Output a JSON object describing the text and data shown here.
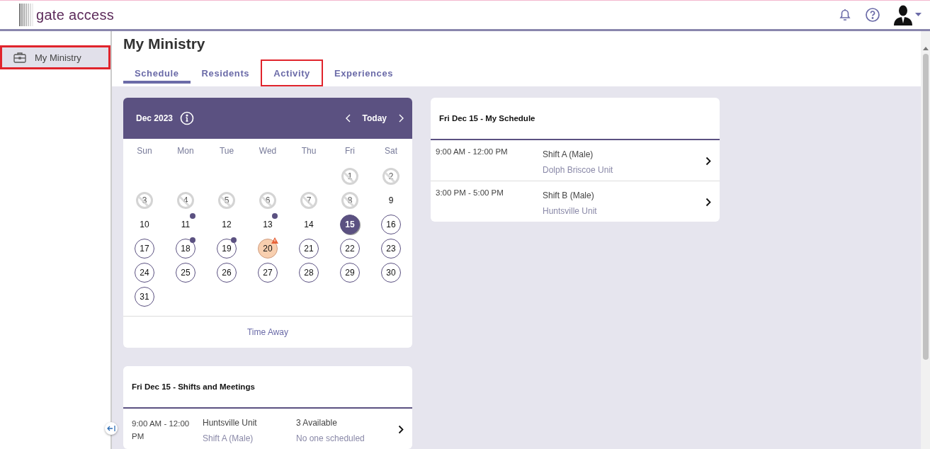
{
  "header": {
    "logo_text": "gate access"
  },
  "sidebar": {
    "items": [
      {
        "label": "My Ministry",
        "selected": true,
        "highlighted": true
      }
    ]
  },
  "page": {
    "title": "My Ministry"
  },
  "tabs": [
    {
      "label": "Schedule",
      "selected": true,
      "highlighted": false
    },
    {
      "label": "Residents",
      "selected": false,
      "highlighted": false
    },
    {
      "label": "Activity",
      "selected": false,
      "highlighted": true
    },
    {
      "label": "Experiences",
      "selected": false,
      "highlighted": false
    }
  ],
  "calendar": {
    "month": "Dec 2023",
    "today_label": "Today",
    "weekdays": [
      "Sun",
      "Mon",
      "Tue",
      "Wed",
      "Thu",
      "Fri",
      "Sat"
    ],
    "weeks": [
      [
        {
          "day": "1",
          "kind": "blocked",
          "event": false
        },
        {
          "day": "2",
          "kind": "blocked",
          "event": false
        }
      ],
      [
        {
          "day": "3",
          "kind": "blocked",
          "event": false
        },
        {
          "day": "4",
          "kind": "blocked",
          "event": false
        },
        {
          "day": "5",
          "kind": "blocked",
          "event": false
        },
        {
          "day": "6",
          "kind": "blocked",
          "event": false
        },
        {
          "day": "7",
          "kind": "blocked",
          "event": false
        },
        {
          "day": "8",
          "kind": "blocked",
          "event": false
        },
        {
          "day": "9",
          "kind": "plain",
          "event": false
        }
      ],
      [
        {
          "day": "10",
          "kind": "plain",
          "event": false
        },
        {
          "day": "11",
          "kind": "plain",
          "event": true
        },
        {
          "day": "12",
          "kind": "plain",
          "event": false
        },
        {
          "day": "13",
          "kind": "plain",
          "event": true
        },
        {
          "day": "14",
          "kind": "plain",
          "event": false
        },
        {
          "day": "15",
          "kind": "selected",
          "event": false
        },
        {
          "day": "16",
          "kind": "open",
          "event": false
        }
      ],
      [
        {
          "day": "17",
          "kind": "open",
          "event": false
        },
        {
          "day": "18",
          "kind": "open",
          "event": true
        },
        {
          "day": "19",
          "kind": "open",
          "event": true
        },
        {
          "day": "20",
          "kind": "warning",
          "event": false
        },
        {
          "day": "21",
          "kind": "open",
          "event": false
        },
        {
          "day": "22",
          "kind": "open",
          "event": false
        },
        {
          "day": "23",
          "kind": "open",
          "event": false
        }
      ],
      [
        {
          "day": "24",
          "kind": "open",
          "event": false
        },
        {
          "day": "25",
          "kind": "open",
          "event": false
        },
        {
          "day": "26",
          "kind": "open",
          "event": false
        },
        {
          "day": "27",
          "kind": "open",
          "event": false
        },
        {
          "day": "28",
          "kind": "open",
          "event": false
        },
        {
          "day": "29",
          "kind": "open",
          "event": false
        },
        {
          "day": "30",
          "kind": "open",
          "event": false
        }
      ],
      [
        {
          "day": "31",
          "kind": "open",
          "event": false
        }
      ]
    ],
    "footer_link": "Time Away"
  },
  "my_schedule": {
    "title": "Fri Dec 15 - My Schedule",
    "rows": [
      {
        "time": "9:00 AM - 12:00 PM",
        "shift": "Shift A (Male)",
        "unit": "Dolph Briscoe Unit"
      },
      {
        "time": "3:00 PM - 5:00 PM",
        "shift": "Shift B (Male)",
        "unit": "Huntsville Unit"
      }
    ]
  },
  "shifts_and_meetings": {
    "title": "Fri Dec 15 - Shifts and Meetings",
    "rows": [
      {
        "time": "9:00 AM - 12:00 PM",
        "unit": "Huntsville Unit",
        "shift": "Shift A (Male)",
        "availability": "3 Available",
        "scheduled": "No one scheduled"
      }
    ]
  }
}
